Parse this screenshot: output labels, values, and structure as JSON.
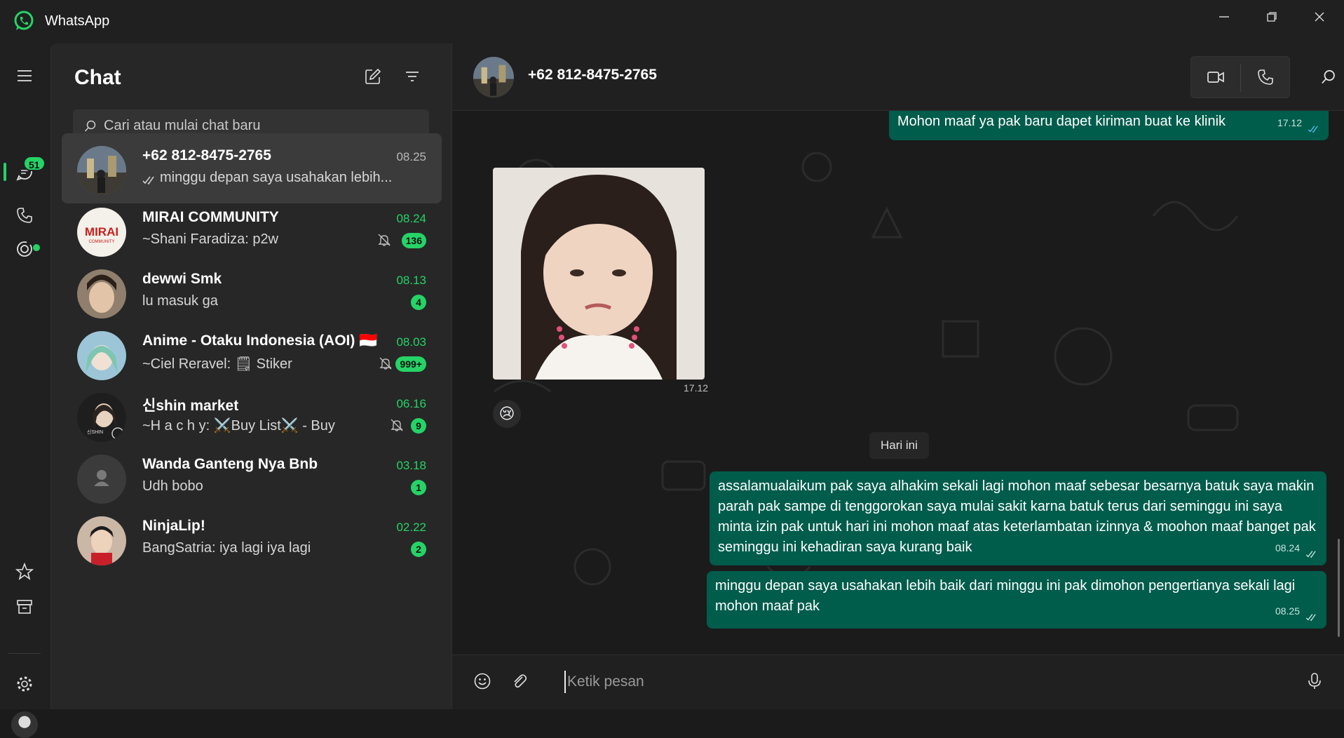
{
  "window": {
    "app_title": "WhatsApp",
    "controls": [
      "minimize-icon",
      "restore-icon",
      "close-icon"
    ]
  },
  "rail": {
    "chats_badge": "51",
    "items": [
      "menu-icon",
      "chat-icon",
      "phone-icon",
      "status-icon",
      "star-icon",
      "archive-icon",
      "gear-icon"
    ]
  },
  "chat_list": {
    "heading": "Chat",
    "search_placeholder": "Cari atau mulai chat baru",
    "chats": [
      {
        "name": "+62 812-8475-2765",
        "time": "08.25",
        "preview": "minggu depan saya usahakan lebih...",
        "badge": "",
        "muted": false,
        "selected": true,
        "read_ticks": true
      },
      {
        "name": "MIRAI COMMUNITY",
        "time": "08.24",
        "preview": "~Shani Faradiza: p2w",
        "badge": "136",
        "muted": true,
        "selected": false
      },
      {
        "name": "dewwi Smk",
        "time": "08.13",
        "preview": "lu masuk ga",
        "badge": "4",
        "muted": false,
        "selected": false
      },
      {
        "name": "Anime - Otaku Indonesia (AOI) 🇮🇩",
        "time": "08.03",
        "preview": "~Ciel Reravel: 🗒 Stiker",
        "badge": "999+",
        "muted": true,
        "selected": false
      },
      {
        "name": "신shin market",
        "time": "06.16",
        "preview": "~H a c h y: ⚔️Buy List⚔️ - Buy Spi...",
        "badge": "9",
        "muted": true,
        "selected": false
      },
      {
        "name": "Wanda Ganteng Nya Bnb",
        "time": "03.18",
        "preview": "Udh bobo",
        "badge": "1",
        "muted": false,
        "selected": false
      },
      {
        "name": "NinjaLip!",
        "time": "02.22",
        "preview": "BangSatria: iya lagi iya lagi",
        "badge": "2",
        "muted": false,
        "selected": false
      }
    ]
  },
  "conversation": {
    "title": "+62 812-8475-2765",
    "messages": [
      {
        "text": "Mohon maaf ya pak baru dapet kiriman buat ke klinik",
        "time": "17.12"
      },
      {
        "type": "image",
        "time": "17.12",
        "reaction": "😢"
      },
      {
        "date_divider": "Hari ini"
      },
      {
        "text": "assalamualaikum pak saya alhakim sekali lagi mohon maaf sebesar besarnya batuk saya makin parah pak sampe di tenggorokan saya mulai sakit karna batuk terus dari seminggu ini saya minta izin pak untuk hari ini mohon maaf atas keterlambatan izinnya & moohon maaf banget pak seminggu ini kehadiran saya kurang baik",
        "time": "08.24"
      },
      {
        "text": "minggu depan saya usahakan lebih baik dari minggu ini pak dimohon pengertianya sekali lagi mohon maaf pak",
        "time": "08.25"
      }
    ],
    "composer_placeholder": "Ketik pesan"
  },
  "colors": {
    "accent": "#25d366",
    "outgoing_bubble": "#005c4b",
    "panel": "#272727",
    "background": "#1b1b1b"
  }
}
